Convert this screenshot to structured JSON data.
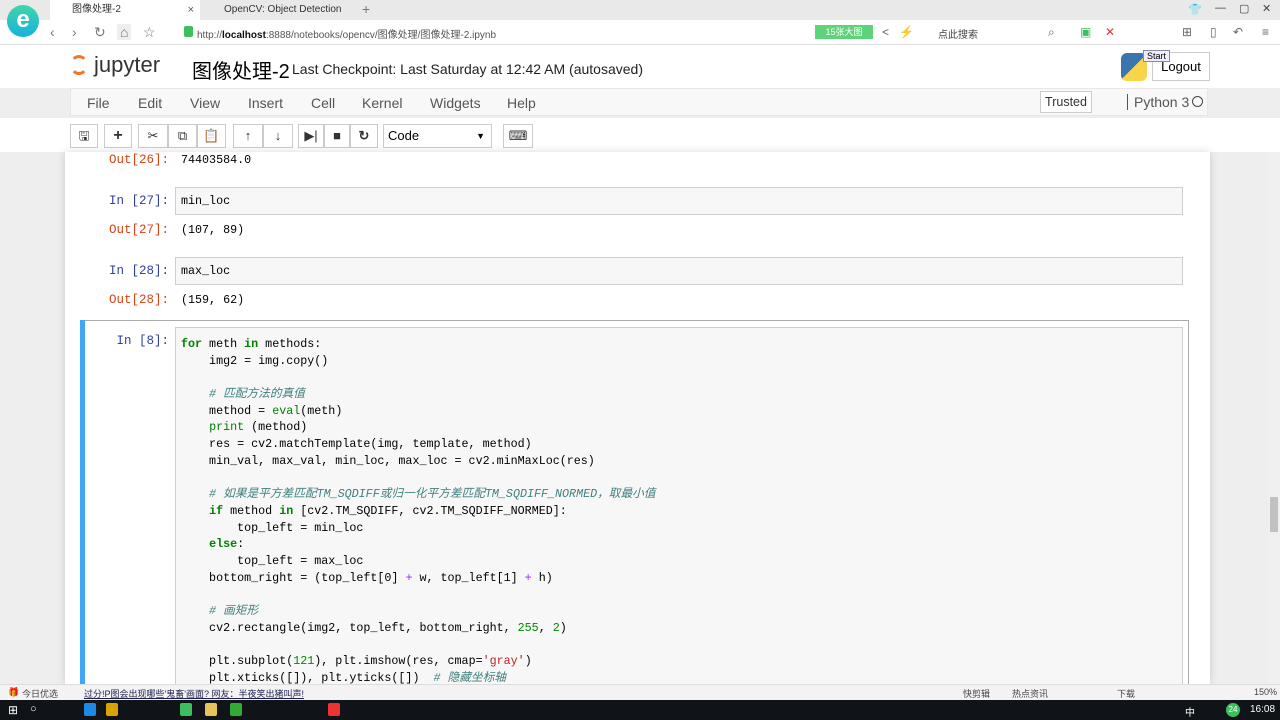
{
  "browser": {
    "tabs": [
      {
        "label": "图像处理-2",
        "active": true
      },
      {
        "label": "OpenCV: Object Detection",
        "active": false
      }
    ],
    "url_prefix": "http://",
    "url_host": "localhost",
    "url_rest": ":8888/notebooks/opencv/图像处理/图像处理-2.ipynb",
    "badge": "15张大图",
    "search_placeholder": "点此搜索"
  },
  "jupyter": {
    "logo": "jupyter",
    "title": "图像处理-2",
    "checkpoint": "Last Checkpoint: Last Saturday at 12:42 AM (autosaved)",
    "logout": "Logout",
    "tooltip": "Start",
    "menu": [
      "File",
      "Edit",
      "View",
      "Insert",
      "Cell",
      "Kernel",
      "Widgets",
      "Help"
    ],
    "trusted": "Trusted",
    "kernel": "Python 3",
    "cell_type": "Code"
  },
  "cells": [
    {
      "prompt": "Out[26]:",
      "text": "74403584.0"
    },
    {
      "prompt": "In [27]:",
      "text": "min_loc"
    },
    {
      "prompt": "Out[27]:",
      "text": "(107, 89)"
    },
    {
      "prompt": "In [28]:",
      "text": "max_loc"
    },
    {
      "prompt": "Out[28]:",
      "text": "(159, 62)"
    }
  ],
  "active_cell": {
    "prompt": "In [8]:",
    "code": [
      [
        [
          "for",
          "kw"
        ],
        [
          " meth ",
          ""
        ],
        [
          "in",
          "kw"
        ],
        [
          " methods:",
          ""
        ]
      ],
      [
        [
          "    img2 = img.copy()",
          ""
        ]
      ],
      [],
      [
        [
          "    # 匹配方法的真值",
          "cm"
        ]
      ],
      [
        [
          "    method = ",
          ""
        ],
        [
          "eval",
          "bi"
        ],
        [
          "(meth)",
          ""
        ]
      ],
      [
        [
          "    ",
          ""
        ],
        [
          "print",
          "bi"
        ],
        [
          " (method)",
          ""
        ]
      ],
      [
        [
          "    res = cv2.matchTemplate(img, template, method)",
          ""
        ]
      ],
      [
        [
          "    min_val, max_val, min_loc, max_loc = cv2.minMaxLoc(res)",
          ""
        ]
      ],
      [],
      [
        [
          "    # 如果是平方差匹配TM_SQDIFF或归一化平方差匹配TM_SQDIFF_NORMED，取最小值",
          "cm"
        ]
      ],
      [
        [
          "    ",
          ""
        ],
        [
          "if",
          "kw"
        ],
        [
          " method ",
          ""
        ],
        [
          "in",
          "kw"
        ],
        [
          " [cv2.TM_SQDIFF, cv2.TM_SQDIFF_NORMED]:",
          ""
        ]
      ],
      [
        [
          "        top_left = min_loc",
          ""
        ]
      ],
      [
        [
          "    ",
          ""
        ],
        [
          "else",
          "kw"
        ],
        [
          ":",
          ""
        ]
      ],
      [
        [
          "        top_left = max_loc",
          ""
        ]
      ],
      [
        [
          "    bottom_right = (top_left[0] ",
          ""
        ],
        [
          "+",
          "op"
        ],
        [
          " w, top_left[1] ",
          ""
        ],
        [
          "+",
          "op"
        ],
        [
          " h)",
          ""
        ]
      ],
      [],
      [
        [
          "    # 画矩形",
          "cm"
        ]
      ],
      [
        [
          "    cv2.rectangle(img2, top_left, bottom_right, ",
          ""
        ],
        [
          "255",
          "nm"
        ],
        [
          ", ",
          ""
        ],
        [
          "2",
          "nm"
        ],
        [
          ")",
          ""
        ]
      ],
      [],
      [
        [
          "    plt.subplot(",
          ""
        ],
        [
          "121",
          "nm"
        ],
        [
          "), plt.imshow(res, cmap=",
          ""
        ],
        [
          "'gray'",
          "st"
        ],
        [
          ")",
          ""
        ]
      ],
      [
        [
          "    plt.xticks([]), plt.yticks([])  ",
          ""
        ],
        [
          "# 隐藏坐标轴",
          "cm"
        ]
      ]
    ]
  },
  "statusbar": {
    "left": "今日优选",
    "news": "过分!P图会出现哪些'鬼畜'画面? 网友：半夜笑出猪叫声!",
    "items": [
      "快剪辑",
      "热点资讯",
      "下载"
    ],
    "zoom": "150%"
  },
  "taskbar": {
    "clock": "16:08",
    "ime": "中",
    "badge": "24"
  },
  "colors": {
    "accent": "#42a5f5",
    "jupyter_orange": "#f37626",
    "in_prompt": "#303f9f",
    "out_prompt": "#d84315"
  }
}
